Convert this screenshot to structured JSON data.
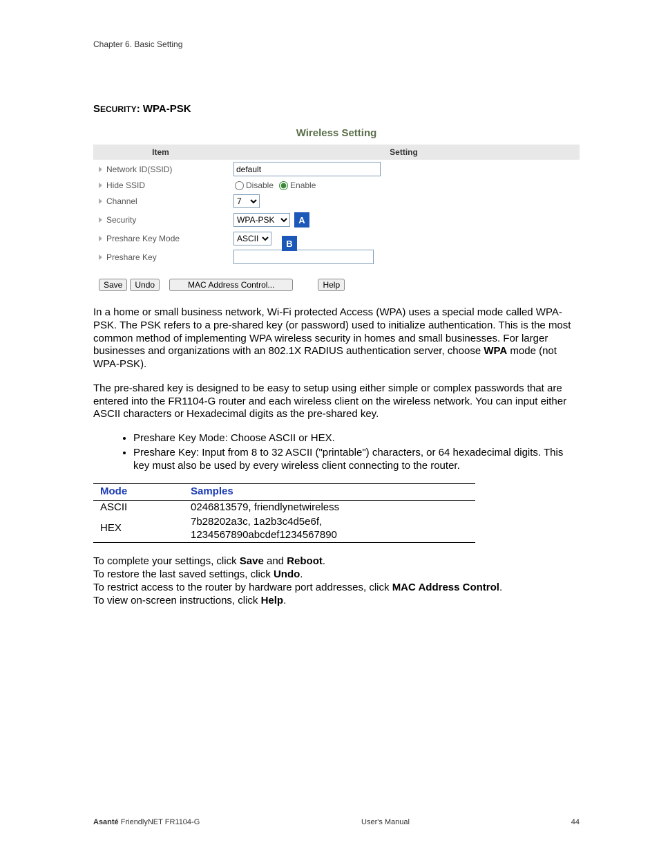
{
  "header": {
    "chapter": "Chapter 6. Basic Setting"
  },
  "section": {
    "prefix": "Security",
    "sep": ": ",
    "name": "WPA-PSK"
  },
  "panel": {
    "title": "Wireless Setting",
    "col_item": "Item",
    "col_setting": "Setting",
    "rows": {
      "ssid": {
        "label": "Network ID(SSID)",
        "value": "default"
      },
      "hide": {
        "label": "Hide SSID",
        "disable": "Disable",
        "enable": "Enable"
      },
      "channel": {
        "label": "Channel",
        "value": "7"
      },
      "security": {
        "label": "Security",
        "value": "WPA-PSK",
        "callout": "A"
      },
      "pkmode": {
        "label": "Preshare Key Mode",
        "value": "ASCII",
        "callout": "B"
      },
      "pkey": {
        "label": "Preshare Key",
        "value": ""
      }
    },
    "buttons": {
      "save": "Save",
      "undo": "Undo",
      "mac": "MAC Address Control...",
      "help": "Help"
    }
  },
  "body": {
    "p1a": "In a home or small business network, Wi-Fi protected Access (WPA) uses a special mode called WPA-PSK. The PSK refers to a pre-shared key (or password) used to initialize authentication. This is the most common method of implementing WPA wireless security in homes and small businesses. For larger businesses and organizations with an 802.1X RADIUS authentication server, choose ",
    "p1b": "WPA",
    "p1c": " mode (not WPA-PSK).",
    "p2": "The pre-shared key is designed to be easy to setup using either simple or complex passwords that are entered into the FR1104-G router and each wireless client on the wireless network.  You can input either ASCII characters or Hexadecimal digits as the pre-shared key.",
    "bullet1": "Preshare Key Mode: Choose ASCII or HEX.",
    "bullet2": "Preshare Key: Input from 8 to 32 ASCII (\"printable\") characters, or 64 hexadecimal digits. This key must also be used by every wireless client connecting to the router.",
    "table": {
      "h1": "Mode",
      "h2": "Samples",
      "r1c1": "ASCII",
      "r1c2": "0246813579, friendlynetwireless",
      "r2c1": "HEX",
      "r2c2": "7b28202a3c, 1a2b3c4d5e6f, 1234567890abcdef1234567890"
    },
    "l1a": "To complete your settings, click ",
    "l1b": "Save",
    "l1c": " and ",
    "l1d": "Reboot",
    "l1e": ".",
    "l2a": "To restore the last saved settings, click ",
    "l2b": "Undo",
    "l2c": ".",
    "l3a": "To restrict access to the router by hardware port addresses, click ",
    "l3b": "MAC Address Control",
    "l3c": ".",
    "l4a": "To view on-screen instructions, click ",
    "l4b": "Help",
    "l4c": "."
  },
  "footer": {
    "brand": "Asanté",
    "product": " FriendlyNET FR1104-G",
    "center": "User's Manual",
    "page": "44"
  }
}
